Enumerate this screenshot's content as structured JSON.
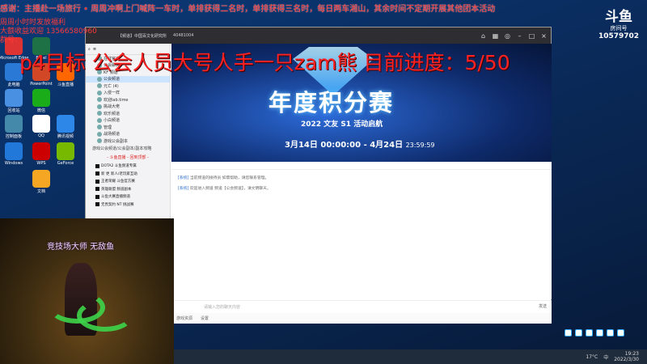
{
  "overlay": {
    "top_text": "感谢：主播赴一场旅行 • 周周冲啊上门喊阵一车时，单排获得二名时，单排获得三名时，每日两车湘山，其余时间不定期开展其他团本活动",
    "left_line_1": "周周小时时发放福利",
    "left_line_2": "大额收益欢迎 13566580960",
    "left_line_3": "群号：",
    "banner": "p4目标 公会人员大号人手一只zam熊 目前进度：5/50"
  },
  "douyu": {
    "logo": "斗鱼",
    "sub": "房间号",
    "room_number": "10579702"
  },
  "desktop_icons": [
    {
      "label": "Microsoft Edge",
      "color": "#d33"
    },
    {
      "label": "此电脑",
      "color": "#2b79d6"
    },
    {
      "label": "回收站",
      "color": "#4a90e2"
    },
    {
      "label": "控制面板",
      "color": "#48a"
    },
    {
      "label": "Windows",
      "color": "#2178d8"
    },
    {
      "label": "QQ",
      "color": "#fff"
    },
    {
      "label": "微信",
      "color": "#1aad19"
    },
    {
      "label": "Excel",
      "color": "#1e7145"
    },
    {
      "label": "PowerPoint",
      "color": "#d24726"
    },
    {
      "label": "斗鱼直播",
      "color": "#f60"
    },
    {
      "label": "腾讯视频",
      "color": "#2c87e8"
    },
    {
      "label": "WPS",
      "color": "#c00"
    },
    {
      "label": "GeForce",
      "color": "#76b900"
    },
    {
      "label": "文档",
      "color": "#f5a623"
    }
  ],
  "window": {
    "title": "【频道】中国百文化研究所",
    "ids": "40481004",
    "channels": [
      {
        "label": "在线官方",
        "active": false,
        "red": false
      },
      {
        "label": "公会聊天",
        "active": false,
        "red": false
      },
      {
        "label": "KF 频道",
        "active": false,
        "red": false
      },
      {
        "label": "公会频道",
        "active": true,
        "red": false
      },
      {
        "label": "元亡 (4)",
        "active": false,
        "red": false
      },
      {
        "label": "入侵一样",
        "active": false,
        "red": false
      },
      {
        "label": "欢迎lab.time",
        "active": false,
        "red": false
      },
      {
        "label": "挑战大佬",
        "active": false,
        "red": false
      },
      {
        "label": "欢乐频道",
        "active": false,
        "red": false
      },
      {
        "label": "小白频道",
        "active": false,
        "red": false
      },
      {
        "label": "管理",
        "active": false,
        "red": false
      },
      {
        "label": "战场频道",
        "active": false,
        "red": false
      },
      {
        "label": "游戏公会副本",
        "active": false,
        "red": false
      }
    ],
    "sub_header": "游戏公会频道/公会副本/副本攻略",
    "divider_label": "- 斗鱼直播 - 回到顶部 -",
    "rooms": [
      "DOTA2 斗鱼频道专属",
      "新 更 新人/老玩家互助",
      "王者荣耀 斗鱼官方赛",
      "英雄联盟 频道副本",
      "斗鱼大赛直播频道",
      "无畏契约 NT 挑战赛"
    ],
    "banner": {
      "title": "年度积分赛",
      "subtitle": "2022 文友 S1 活动启航",
      "date_range": "3月14日 00:00:00 - 4月24日",
      "end_time": "23:59:59"
    },
    "messages": [
      {
        "who": "[系统]",
        "text": "当前频道的接待员 如需帮助，请您联系管理。"
      },
      {
        "who": "[系统]",
        "text": "欢迎进入频道 频道【公会频道】，请文明聊天。"
      }
    ],
    "input_placeholder": "请输入您的聊天内容",
    "send_label": "发送",
    "bottom_items": [
      "游戏资源",
      "设置"
    ]
  },
  "game": {
    "caption": "竞技场大师 无敌鱼"
  },
  "taskbar": {
    "temp": "17°C",
    "ime": "中",
    "time": "19:23",
    "date": "2022/3/30"
  }
}
